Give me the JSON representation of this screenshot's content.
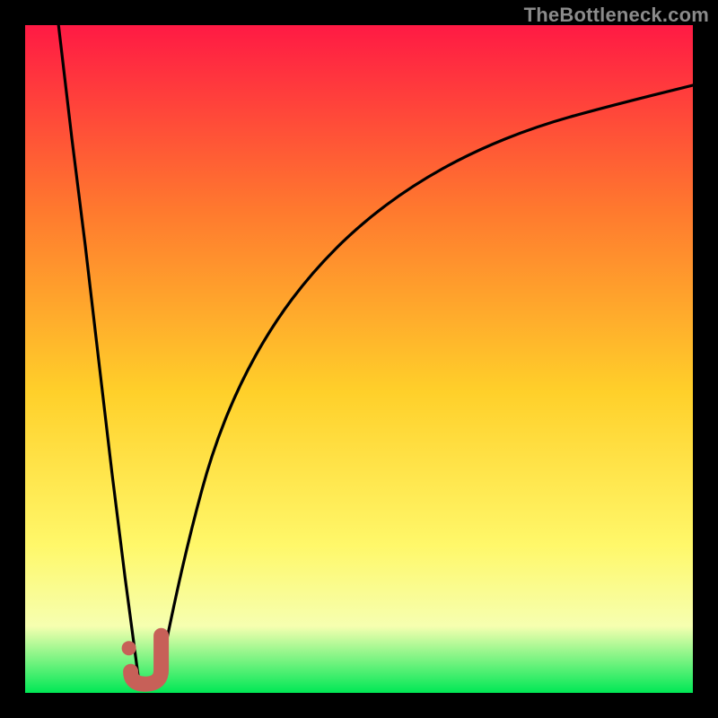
{
  "watermark": "TheBottleneck.com",
  "colors": {
    "bg_black": "#000000",
    "grad_top": "#ff1a44",
    "grad_mid_upper": "#ff7a2e",
    "grad_mid": "#ffd02a",
    "grad_lower": "#fff86a",
    "grad_pale": "#f6ffb0",
    "grad_green": "#00e855",
    "curve": "#000000",
    "marker": "#c76058"
  },
  "chart_data": {
    "type": "line",
    "title": "",
    "xlabel": "",
    "ylabel": "",
    "xlim": [
      0,
      100
    ],
    "ylim": [
      0,
      100
    ],
    "series": [
      {
        "name": "left-branch",
        "x": [
          5,
          7,
          9,
          11,
          13,
          15,
          17
        ],
        "values": [
          100,
          83,
          67,
          50,
          33,
          17,
          2
        ]
      },
      {
        "name": "right-branch",
        "x": [
          20,
          22,
          25,
          28,
          32,
          37,
          43,
          50,
          58,
          67,
          77,
          88,
          100
        ],
        "values": [
          2,
          12,
          25,
          36,
          46,
          55,
          63,
          70,
          76,
          81,
          85,
          88,
          91
        ]
      }
    ],
    "annotations": [
      {
        "name": "j-marker",
        "approx_x": 18.5,
        "approx_y": 4,
        "glyph": "J-with-dot"
      }
    ]
  }
}
